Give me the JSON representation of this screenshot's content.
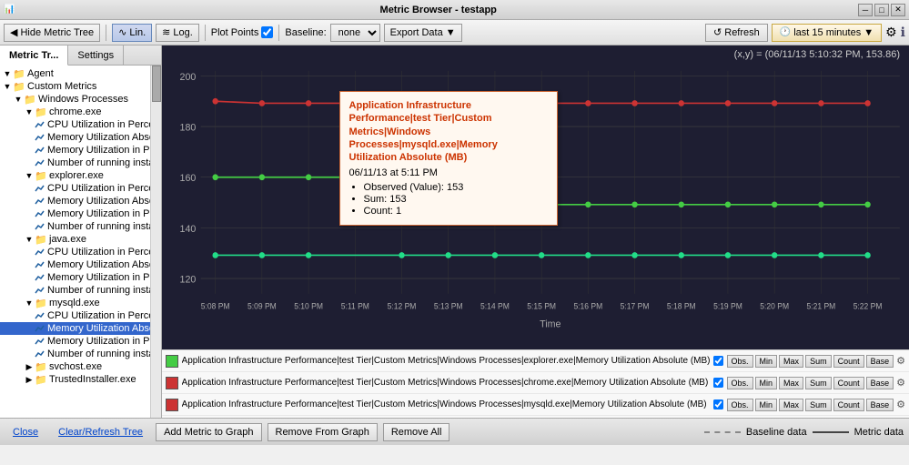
{
  "titlebar": {
    "title": "Metric Browser - testapp",
    "btn_minimize": "─",
    "btn_maximize": "□",
    "btn_close": "✕"
  },
  "toolbar": {
    "hide_metric_tree": "Hide Metric Tree",
    "lin_label": "Lin.",
    "log_label": "Log.",
    "plot_points_label": "Plot Points",
    "baseline_label": "Baseline:",
    "baseline_value": "none",
    "export_data_label": "Export Data",
    "refresh_label": "Refresh",
    "time_range_label": "last 15 minutes"
  },
  "panel": {
    "tab_metric_tree": "Metric Tr...",
    "tab_settings": "Settings"
  },
  "tree": {
    "items": [
      {
        "level": 0,
        "type": "folder",
        "label": "Agent",
        "expanded": true,
        "id": "agent"
      },
      {
        "level": 0,
        "type": "folder",
        "label": "Custom Metrics",
        "expanded": true,
        "id": "custom-metrics"
      },
      {
        "level": 1,
        "type": "folder",
        "label": "Windows Processes",
        "expanded": true,
        "id": "windows-processes"
      },
      {
        "level": 2,
        "type": "folder",
        "label": "chrome.exe",
        "expanded": true,
        "id": "chrome"
      },
      {
        "level": 3,
        "type": "metric",
        "label": "CPU Utilization in Percent",
        "id": "chrome-cpu"
      },
      {
        "level": 3,
        "type": "metric",
        "label": "Memory Utilization Absolute (MB)",
        "id": "chrome-mem-abs"
      },
      {
        "level": 3,
        "type": "metric",
        "label": "Memory Utilization in Percent",
        "id": "chrome-mem-pct"
      },
      {
        "level": 3,
        "type": "metric",
        "label": "Number of running instances",
        "id": "chrome-instances"
      },
      {
        "level": 2,
        "type": "folder",
        "label": "explorer.exe",
        "expanded": true,
        "id": "explorer"
      },
      {
        "level": 3,
        "type": "metric",
        "label": "CPU Utilization in Percent",
        "id": "explorer-cpu"
      },
      {
        "level": 3,
        "type": "metric",
        "label": "Memory Utilization Absolute (MB)",
        "id": "explorer-mem-abs"
      },
      {
        "level": 3,
        "type": "metric",
        "label": "Memory Utilization in Percent",
        "id": "explorer-mem-pct"
      },
      {
        "level": 3,
        "type": "metric",
        "label": "Number of running instances",
        "id": "explorer-instances"
      },
      {
        "level": 2,
        "type": "folder",
        "label": "java.exe",
        "expanded": true,
        "id": "java"
      },
      {
        "level": 3,
        "type": "metric",
        "label": "CPU Utilization in Percent",
        "id": "java-cpu"
      },
      {
        "level": 3,
        "type": "metric",
        "label": "Memory Utilization Absolute (MB)",
        "id": "java-mem-abs"
      },
      {
        "level": 3,
        "type": "metric",
        "label": "Memory Utilization in Percent",
        "id": "java-mem-pct"
      },
      {
        "level": 3,
        "type": "metric",
        "label": "Number of running instances",
        "id": "java-instances"
      },
      {
        "level": 2,
        "type": "folder",
        "label": "mysqld.exe",
        "expanded": true,
        "id": "mysqld",
        "selected": false
      },
      {
        "level": 3,
        "type": "metric",
        "label": "CPU Utilization in Percent",
        "id": "mysqld-cpu"
      },
      {
        "level": 3,
        "type": "metric",
        "label": "Memory Utilization Absolute (MB)",
        "id": "mysqld-mem-abs",
        "selected": true
      },
      {
        "level": 3,
        "type": "metric",
        "label": "Memory Utilization in Percent",
        "id": "mysqld-mem-pct"
      },
      {
        "level": 3,
        "type": "metric",
        "label": "Number of running instances",
        "id": "mysqld-instances"
      },
      {
        "level": 2,
        "type": "folder",
        "label": "svchost.exe",
        "expanded": false,
        "id": "svchost"
      },
      {
        "level": 2,
        "type": "folder",
        "label": "TrustedInstaller.exe",
        "expanded": false,
        "id": "trustedinstaller"
      }
    ]
  },
  "graph": {
    "coords_label": "(x,y) = (06/11/13 5:10:32 PM, 153.86)",
    "y_axis_labels": [
      "200",
      "180",
      "160",
      "140",
      "120"
    ],
    "x_axis_labels": [
      "5:08 PM",
      "5:09 PM",
      "5:10 PM",
      "5:11 PM",
      "5:12 PM",
      "5:13 PM",
      "5:14 PM",
      "5:15 PM",
      "5:16 PM",
      "5:17 PM",
      "5:18 PM",
      "5:19 PM",
      "5:20 PM",
      "5:21 PM",
      "5:22 PM"
    ],
    "x_axis_title": "Time",
    "tooltip": {
      "title": "Application Infrastructure Performance|test Tier|Custom Metrics|Windows Processes|mysqld.exe|Memory Utilization Absolute (MB)",
      "date": "06/11/13 at 5:11 PM",
      "observed": "Observed (Value): 153",
      "sum": "Sum: 153",
      "count": "Count: 1"
    }
  },
  "legend": {
    "rows": [
      {
        "color": "#44cc44",
        "label": "Application Infrastructure Performance|test Tier|Custom Metrics|Windows Processes|explorer.exe|Memory Utilization Absolute (MB)",
        "checked": true
      },
      {
        "color": "#cc3333",
        "label": "Application Infrastructure Performance|test Tier|Custom Metrics|Windows Processes|chrome.exe|Memory Utilization Absolute (MB)",
        "checked": true
      },
      {
        "color": "#cc3333",
        "label": "Application Infrastructure Performance|test Tier|Custom Metrics|Windows Processes|mysqld.exe|Memory Utilization Absolute (MB)",
        "checked": true
      }
    ],
    "metric_buttons": [
      "Obs.",
      "Min",
      "Max",
      "Sum",
      "Count",
      "Base"
    ]
  },
  "bottom_bar": {
    "close_label": "Close",
    "clear_refresh_label": "Clear/Refresh Tree",
    "add_metric_label": "Add Metric to Graph",
    "remove_from_graph_label": "Remove From Graph",
    "remove_all_label": "Remove All",
    "baseline_info_label": "Baseline data",
    "metric_info_label": "Metric data"
  }
}
